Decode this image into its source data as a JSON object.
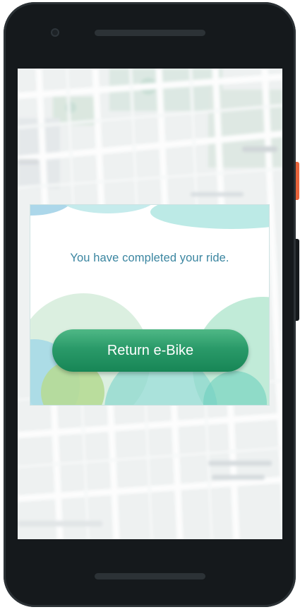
{
  "dialog": {
    "message": "You have completed your ride.",
    "return_button_label": "Return e-Bike"
  },
  "colors": {
    "phone_body": "#15191c",
    "power_button": "#e8643c",
    "message_text": "#3a85a0",
    "button_green": "#2a9a69"
  },
  "icons": {
    "camera": "front-camera-icon"
  }
}
